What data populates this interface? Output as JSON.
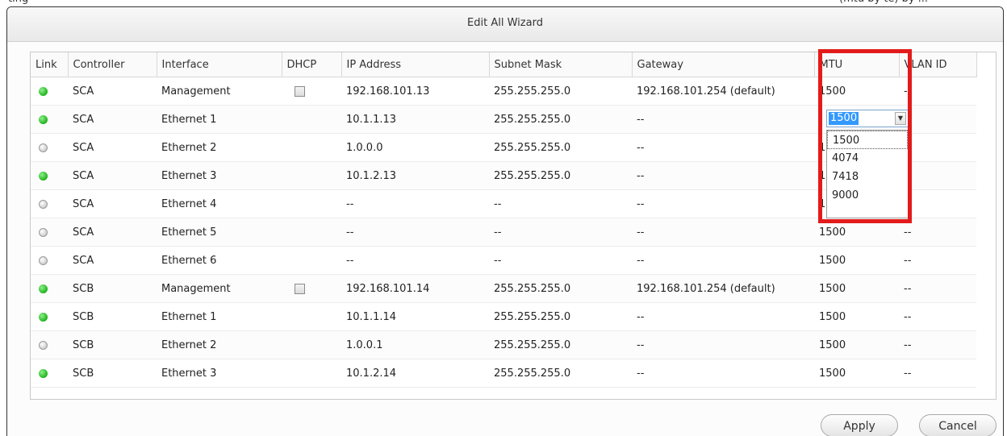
{
  "top_strip_text": "ting                                                                                                                                                 (mtu by te) by ...",
  "window": {
    "title": "Edit All Wizard"
  },
  "table": {
    "headers": [
      "Link",
      "Controller",
      "Interface",
      "DHCP",
      "IP Address",
      "Subnet Mask",
      "Gateway",
      "MTU",
      "VLAN ID"
    ],
    "rows": [
      {
        "link": "green",
        "controller": "SCA",
        "interface": "Management",
        "dhcp": true,
        "ip": "192.168.101.13",
        "subnet": "255.255.255.0",
        "gateway": "192.168.101.254 (default)",
        "mtu": "1500",
        "vlan": "--"
      },
      {
        "link": "green",
        "controller": "SCA",
        "interface": "Ethernet 1",
        "dhcp": false,
        "ip": "10.1.1.13",
        "subnet": "255.255.255.0",
        "gateway": "--",
        "mtu": "1500",
        "vlan": "--"
      },
      {
        "link": "gray",
        "controller": "SCA",
        "interface": "Ethernet 2",
        "dhcp": false,
        "ip": "1.0.0.0",
        "subnet": "255.255.255.0",
        "gateway": "--",
        "mtu": "1500",
        "vlan": "--"
      },
      {
        "link": "green",
        "controller": "SCA",
        "interface": "Ethernet 3",
        "dhcp": false,
        "ip": "10.1.2.13",
        "subnet": "255.255.255.0",
        "gateway": "--",
        "mtu": "1500",
        "vlan": "--"
      },
      {
        "link": "gray",
        "controller": "SCA",
        "interface": "Ethernet 4",
        "dhcp": false,
        "ip": "--",
        "subnet": "--",
        "gateway": "--",
        "mtu": "1500",
        "vlan": "--"
      },
      {
        "link": "gray",
        "controller": "SCA",
        "interface": "Ethernet 5",
        "dhcp": false,
        "ip": "--",
        "subnet": "--",
        "gateway": "--",
        "mtu": "1500",
        "vlan": "--"
      },
      {
        "link": "gray",
        "controller": "SCA",
        "interface": "Ethernet 6",
        "dhcp": false,
        "ip": "--",
        "subnet": "--",
        "gateway": "--",
        "mtu": "1500",
        "vlan": "--"
      },
      {
        "link": "green",
        "controller": "SCB",
        "interface": "Management",
        "dhcp": true,
        "ip": "192.168.101.14",
        "subnet": "255.255.255.0",
        "gateway": "192.168.101.254 (default)",
        "mtu": "1500",
        "vlan": "--"
      },
      {
        "link": "green",
        "controller": "SCB",
        "interface": "Ethernet 1",
        "dhcp": false,
        "ip": "10.1.1.14",
        "subnet": "255.255.255.0",
        "gateway": "--",
        "mtu": "1500",
        "vlan": "--"
      },
      {
        "link": "gray",
        "controller": "SCB",
        "interface": "Ethernet 2",
        "dhcp": false,
        "ip": "1.0.0.1",
        "subnet": "255.255.255.0",
        "gateway": "--",
        "mtu": "1500",
        "vlan": "--"
      },
      {
        "link": "green",
        "controller": "SCB",
        "interface": "Ethernet 3",
        "dhcp": false,
        "ip": "10.1.2.14",
        "subnet": "255.255.255.0",
        "gateway": "--",
        "mtu": "1500",
        "vlan": "--"
      }
    ]
  },
  "mtu_dropdown": {
    "selected": "1500",
    "options": [
      "1500",
      "4074",
      "7418",
      "9000"
    ]
  },
  "buttons": {
    "apply": "Apply",
    "cancel": "Cancel"
  },
  "colors": {
    "highlight": "#e31b1b",
    "link_up": "#1fb31b",
    "link_down": "#cfcfcf"
  }
}
